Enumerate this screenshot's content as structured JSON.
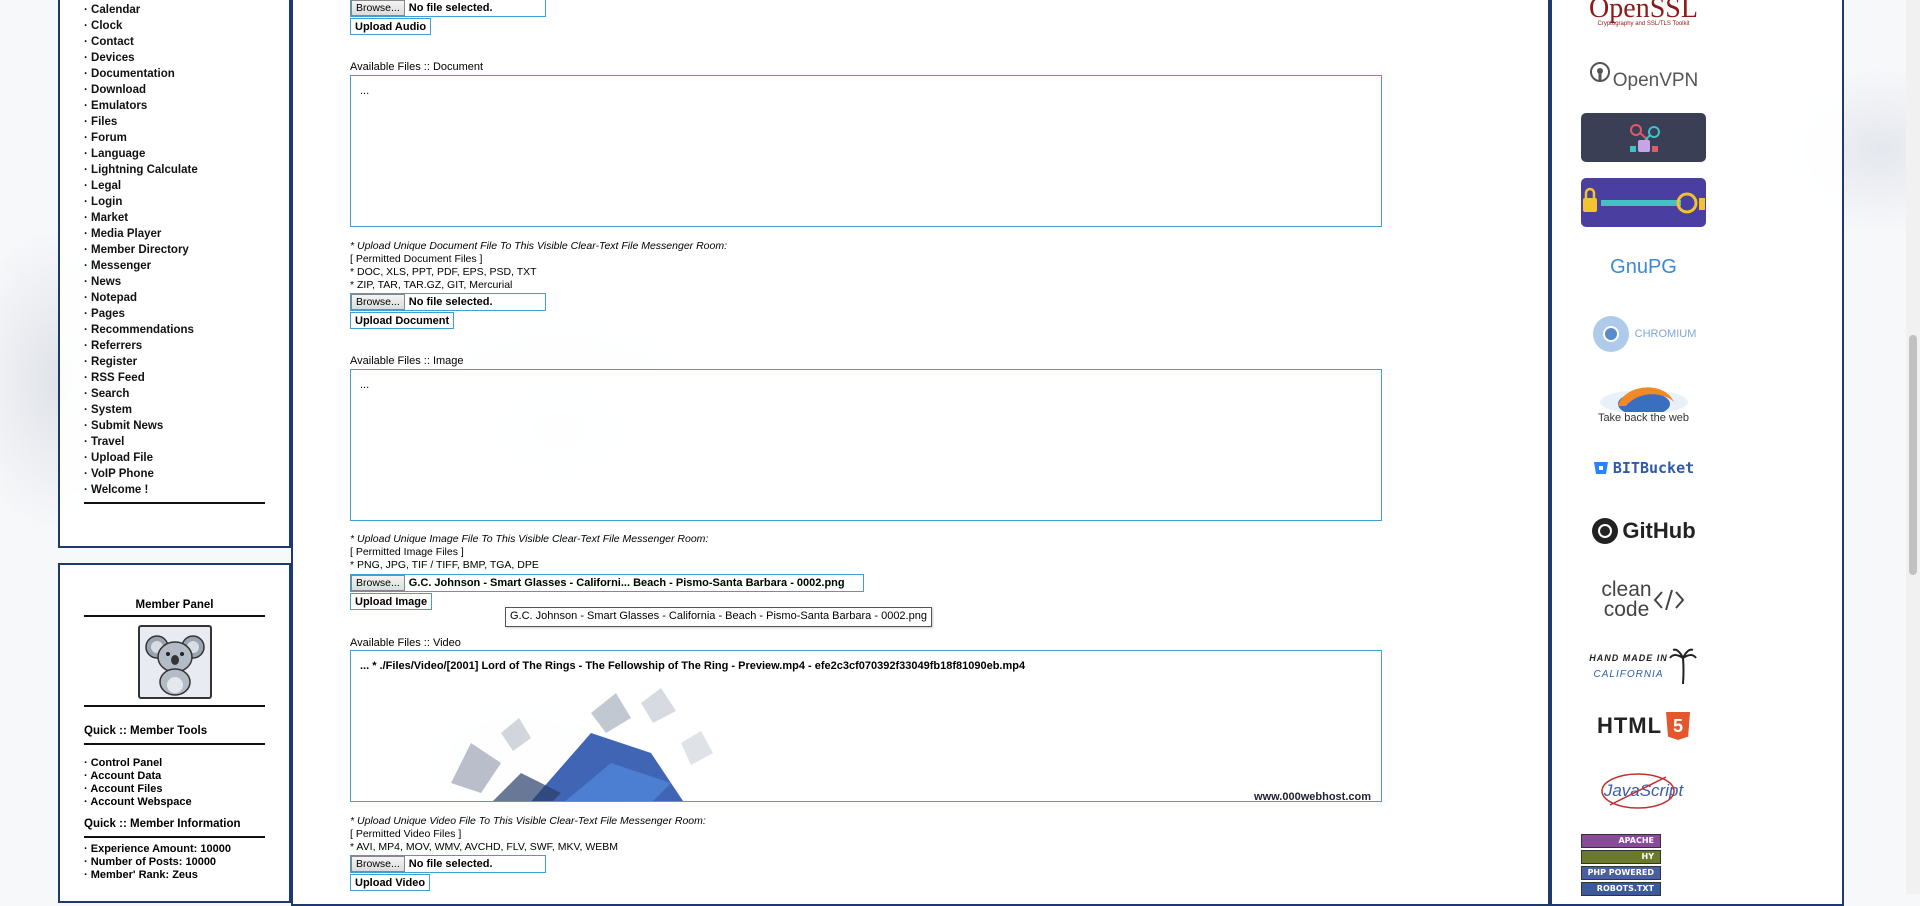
{
  "left_nav": {
    "items": [
      "Calendar",
      "Clock",
      "Contact",
      "Devices",
      "Documentation",
      "Download",
      "Emulators",
      "Files",
      "Forum",
      "Language",
      "Lightning Calculate",
      "Legal",
      "Login",
      "Market",
      "Media Player",
      "Member Directory",
      "Messenger",
      "News",
      "Notepad",
      "Pages",
      "Recommendations",
      "Referrers",
      "Register",
      "RSS Feed",
      "Search",
      "System",
      "Submit News",
      "Travel",
      "Upload File",
      "VoIP Phone",
      "Welcome !"
    ],
    "bullet": "·"
  },
  "member_panel": {
    "title": "Member Panel",
    "tools_heading": "Quick :: Member Tools",
    "tools": [
      "Control Panel",
      "Account Data",
      "Account Files",
      "Account Webspace"
    ],
    "info_heading": "Quick :: Member Information",
    "info": [
      "Experience Amount: 10000",
      "Number of Posts: 10000",
      "Member' Rank: Zeus"
    ]
  },
  "audio": {
    "browse_label": "Browse...",
    "file_name": "No file selected.",
    "upload_label": "Upload Audio"
  },
  "document": {
    "label_prefix": "Available Files :: ",
    "label_name": "Document",
    "list_text": "...",
    "note_title": "* Upload Unique Document File To This Visible Clear-Text File Messenger Room:",
    "permitted": "[ Permitted Document Files ]",
    "types_1": "* DOC, XLS, PPT, PDF, EPS, PSD, TXT",
    "types_2": "* ZIP, TAR, TAR.GZ, GIT, Mercurial",
    "browse_label": "Browse...",
    "file_name": "No file selected.",
    "upload_label": "Upload Document"
  },
  "image": {
    "label_prefix": "Available Files :: ",
    "label_name": "Image",
    "list_text": "...",
    "note_title": "* Upload Unique Image File To This Visible Clear-Text File Messenger Room:",
    "permitted": "[ Permitted Image Files ]",
    "types_1": "* PNG, JPG, TIF / TIFF, BMP, TGA, DPE",
    "browse_label": "Browse...",
    "file_name": "G.C. Johnson - Smart Glasses - Californi... Beach - Pismo-Santa Barbara - 0002.png",
    "tooltip": "G.C. Johnson - Smart Glasses - California - Beach - Pismo-Santa Barbara - 0002.png",
    "upload_label": "Upload Image"
  },
  "video": {
    "label_prefix": "Available Files :: ",
    "label_name": "Video",
    "list_text": "... * ./Files/Video/[2001] Lord of The Rings - The Fellowship of The Ring - Preview.mp4 - efe2c3cf070392f33049fb18f81090eb.mp4",
    "watermark": "www.000webhost.com",
    "note_title": "* Upload Unique Video File To This Visible Clear-Text File Messenger Room:",
    "permitted": "[ Permitted Video Files ]",
    "types_1": "* AVI, MP4, MOV, WMV, AVCHD, FLV, SWF, MKV, WEBM",
    "browse_label": "Browse...",
    "file_name": "No file selected.",
    "upload_label": "Upload Video"
  },
  "sponsors": {
    "openssl": "OpenSSL",
    "openssl_tag": "Cryptography and SSL/TLS Toolkit",
    "openvpn": "OpenVPN",
    "gnupg": "GnuPG",
    "chromium": "CHROMIUM",
    "firefox": "Take back the web",
    "bitbucket": "BITBucket",
    "github": "GitHub",
    "cleancode_1": "clean",
    "cleancode_2": "code",
    "handmade_1": "HAND MADE IN",
    "handmade_2": "CALIFORNIA",
    "html5": "HTML",
    "html5_badge": "5",
    "javascript": "JavaScript",
    "badges": [
      "APACHE",
      "HY",
      "PHP POWERED",
      "ROBOTS.TXT"
    ]
  },
  "colors": {
    "border": "#1d3a6e",
    "field_border": "#3fa0d6"
  }
}
